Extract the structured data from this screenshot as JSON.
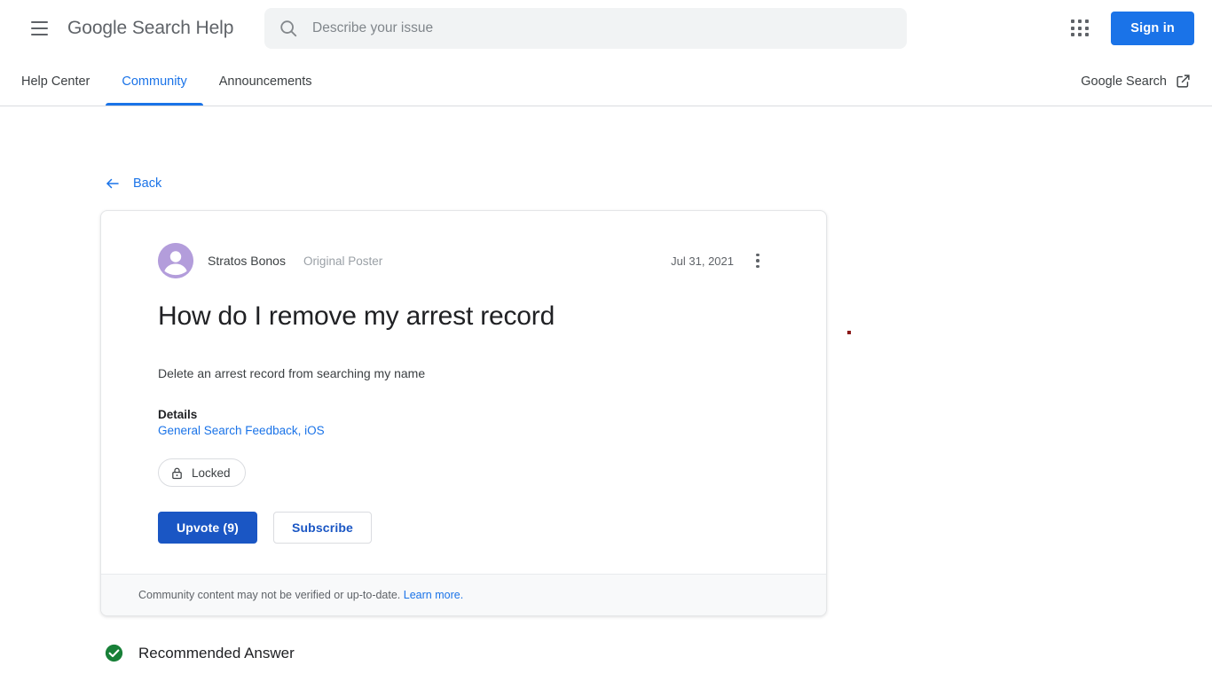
{
  "header": {
    "menu_icon": "hamburger-menu-icon",
    "product_name": "Google Search Help",
    "search": {
      "icon": "search-icon",
      "placeholder": "Describe your issue",
      "value": ""
    },
    "apps_icon": "apps-grid-icon",
    "sign_in_label": "Sign in"
  },
  "nav": {
    "tabs": [
      {
        "label": "Help Center",
        "active": false
      },
      {
        "label": "Community",
        "active": true
      },
      {
        "label": "Announcements",
        "active": false
      }
    ],
    "external_link": {
      "label": "Google Search",
      "icon": "external-link-icon"
    }
  },
  "main": {
    "back": {
      "label": "Back",
      "icon": "arrow-left-icon"
    },
    "post": {
      "avatar_icon": "person-avatar-icon",
      "author": "Stratos Bonos",
      "author_badge": "Original Poster",
      "date": "Jul 31, 2021",
      "menu_icon": "more-vertical-icon",
      "title": "How do I remove my arrest record",
      "body": "Delete an arrest record from searching my name",
      "details_label": "Details",
      "details_value": "General Search Feedback, iOS",
      "status_chip": {
        "icon": "lock-icon",
        "label": "Locked"
      },
      "upvote_label": "Upvote (9)",
      "subscribe_label": "Subscribe",
      "footer_text": "Community content may not be verified or up-to-date.",
      "footer_link": "Learn more."
    },
    "recommended_answer": {
      "icon": "check-circle-icon",
      "label": "Recommended Answer"
    }
  },
  "colors": {
    "accent_blue": "#1a73e8",
    "button_blue": "#1a56c4",
    "avatar_purple": "#b39ddb",
    "check_green": "#188038",
    "search_bg": "#f1f3f4",
    "footer_bg": "#f8f9fa",
    "marker_red": "#8b1a1a"
  }
}
